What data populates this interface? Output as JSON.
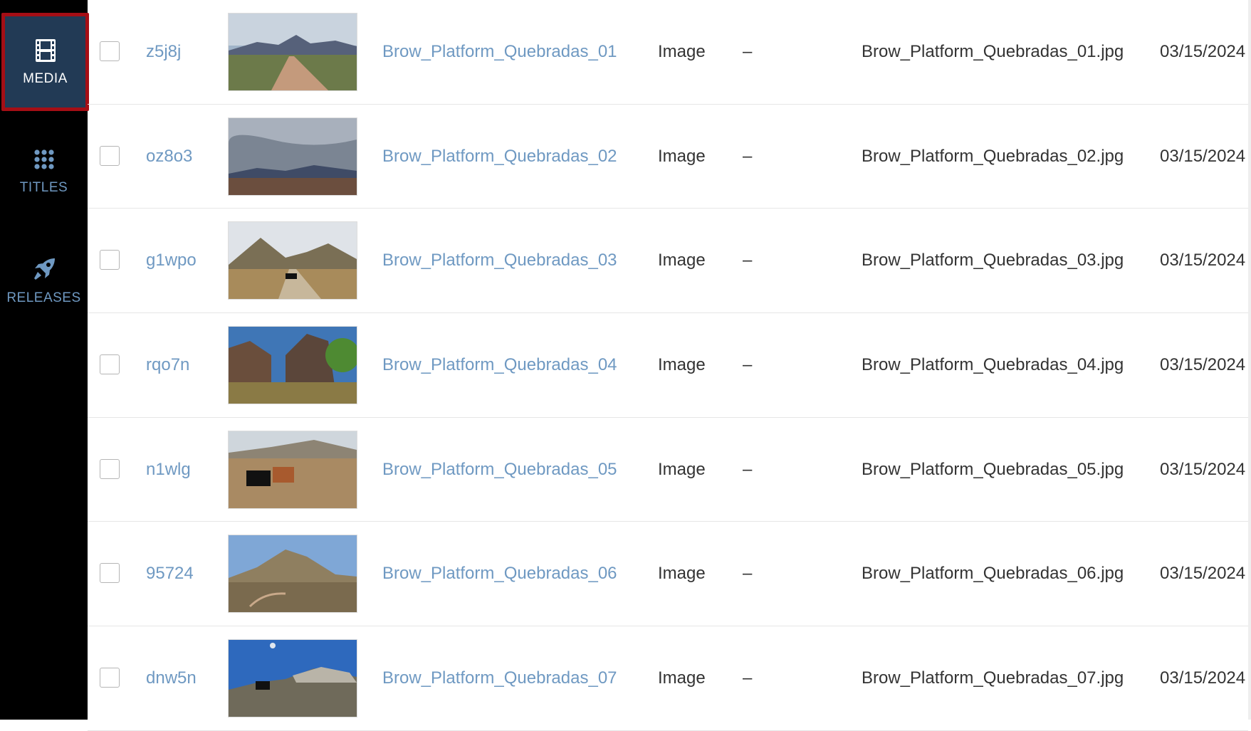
{
  "sidebar": {
    "items": [
      {
        "label": "MEDIA",
        "icon": "film-icon",
        "active": true
      },
      {
        "label": "TITLES",
        "icon": "grid-dots-icon",
        "active": false
      },
      {
        "label": "RELEASES",
        "icon": "rocket-icon",
        "active": false
      }
    ],
    "colors": {
      "background": "#000000",
      "active_bg": "#223a55",
      "active_border": "#a50e15",
      "label": "#6f99c2"
    }
  },
  "rows": [
    {
      "id": "z5j8j",
      "name": "Brow_Platform_Quebradas_01",
      "type": "Image",
      "dash": "–",
      "file": "Brow_Platform_Quebradas_01.jpg",
      "date": "03/15/2024",
      "thumb": "desert-road-mountains"
    },
    {
      "id": "oz8o3",
      "name": "Brow_Platform_Quebradas_02",
      "type": "Image",
      "dash": "–",
      "file": "Brow_Platform_Quebradas_02.jpg",
      "date": "03/15/2024",
      "thumb": "storm-clouds-plain"
    },
    {
      "id": "g1wpo",
      "name": "Brow_Platform_Quebradas_03",
      "type": "Image",
      "dash": "–",
      "file": "Brow_Platform_Quebradas_03.jpg",
      "date": "03/15/2024",
      "thumb": "hills-cow-road"
    },
    {
      "id": "rqo7n",
      "name": "Brow_Platform_Quebradas_04",
      "type": "Image",
      "dash": "–",
      "file": "Brow_Platform_Quebradas_04.jpg",
      "date": "03/15/2024",
      "thumb": "canyon-pond-tree"
    },
    {
      "id": "n1wlg",
      "name": "Brow_Platform_Quebradas_05",
      "type": "Image",
      "dash": "–",
      "file": "Brow_Platform_Quebradas_05.jpg",
      "date": "03/15/2024",
      "thumb": "calves-grassland"
    },
    {
      "id": "95724",
      "name": "Brow_Platform_Quebradas_06",
      "type": "Image",
      "dash": "–",
      "file": "Brow_Platform_Quebradas_06.jpg",
      "date": "03/15/2024",
      "thumb": "hill-trail-scrub"
    },
    {
      "id": "dnw5n",
      "name": "Brow_Platform_Quebradas_07",
      "type": "Image",
      "dash": "–",
      "file": "Brow_Platform_Quebradas_07.jpg",
      "date": "03/15/2024",
      "thumb": "bull-rocky-ridge"
    }
  ],
  "colors": {
    "link": "#6f99c2",
    "text": "#333333",
    "divider": "#e6e6e6"
  }
}
